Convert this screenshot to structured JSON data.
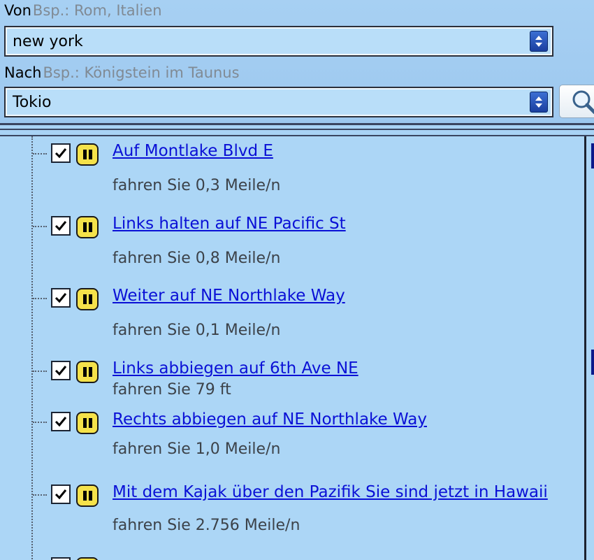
{
  "from": {
    "label": "Von",
    "hint": "Bsp.: Rom, Italien",
    "value": "new york"
  },
  "to": {
    "label": "Nach",
    "hint": "Bsp.: Königstein im Taunus",
    "value": "Tokio"
  },
  "icons": {
    "search": "magnifier-icon",
    "dropdown": "dropdown-arrows-icon",
    "checkbox": "checkmark-icon",
    "pause": "pause-icon"
  },
  "colors": {
    "link": "#0a10d6",
    "panel_bg": "#a9d3f5",
    "pause_yellow": "#f5e24a",
    "combo_button": "#1a3f9f"
  },
  "steps": [
    {
      "title": "Auf Montlake Blvd E",
      "distance": "fahren Sie 0,3 Meile/n",
      "checked": true
    },
    {
      "title": "Links halten auf NE Pacific St",
      "distance": "fahren Sie 0,8 Meile/n",
      "checked": true
    },
    {
      "title": "Weiter auf NE Northlake Way",
      "distance": "fahren Sie 0,1 Meile/n",
      "checked": true
    },
    {
      "title": "Links abbiegen auf 6th Ave NE",
      "distance": "fahren Sie 79 ft",
      "checked": true
    },
    {
      "title": "Rechts abbiegen auf NE Northlake Way",
      "distance": "fahren Sie 1,0 Meile/n",
      "checked": true
    },
    {
      "title": "Mit dem Kajak über den Pazifik Sie sind jetzt in Hawaii",
      "distance": "fahren Sie 2.756 Meile/n",
      "checked": true
    }
  ]
}
